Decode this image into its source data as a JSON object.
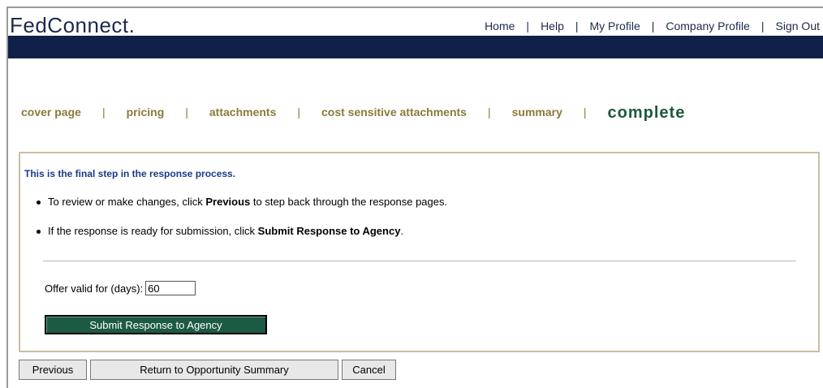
{
  "app": {
    "logo_text": "FedConnect",
    "logo_mark": "."
  },
  "top_nav": {
    "items": [
      "Home",
      "Help",
      "My Profile",
      "Company Profile",
      "Sign Out"
    ],
    "separator": "|"
  },
  "steps": {
    "items": [
      "cover page",
      "pricing",
      "attachments",
      "cost sensitive attachments",
      "summary"
    ],
    "current": "complete",
    "separator": "|"
  },
  "content": {
    "heading": "This is the final step in the response process.",
    "instruction1": {
      "before": "To review or make changes, click ",
      "bold": "Previous",
      "after": " to step back through the response pages."
    },
    "instruction2": {
      "before": "If the response is ready for submission, click ",
      "bold": "Submit Response to Agency",
      "after": "."
    },
    "offer_label": "Offer valid for (days):",
    "offer_value": "60",
    "submit_label": "Submit Response to Agency"
  },
  "bottom_buttons": {
    "previous": "Previous",
    "return_summary": "Return to Opportunity Summary",
    "cancel": "Cancel"
  },
  "colors": {
    "nav_bar": "#0f2148",
    "step_link": "#8a7a3a",
    "step_current": "#1d5a3a",
    "heading": "#1a3a8a",
    "submit_button": "#1d5a44",
    "box_border": "#c9bfa0"
  }
}
